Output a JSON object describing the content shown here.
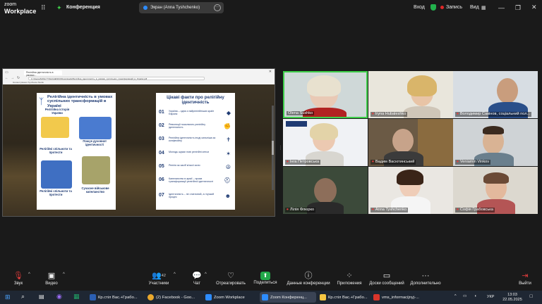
{
  "app": {
    "brand_line1": "zoom",
    "brand_line2": "Workplace",
    "meeting_title": "Конференция"
  },
  "screen_share": {
    "label": "Экран (Anna Tyshchenko)"
  },
  "top_right": {
    "login": "Вход",
    "record": "Запись",
    "view": "Вид"
  },
  "browser": {
    "tab_title": "Релігійна ідентичність в умовах...",
    "address": "C:/Users/ANNA TYSHCHENKO/Downloads/Релігійна_ідентичність_в_умовах_суспільних_трансформацій_в_Україні.pdf",
    "bookmarks": "Налаштування   Synthesia Studio"
  },
  "slide1": {
    "title": "Релігійна ідентичність в умовах суспільних трансформацій в Україні",
    "labels": [
      "Релігійна історія України",
      "Пошук духовної ідентичності",
      "Релігійні спільноти та протести",
      "Релігійні спільноти та протести",
      "Сучасне військове капеланство"
    ]
  },
  "slide2": {
    "title": "Цікаві факти про релігійну ідентичність",
    "facts": [
      {
        "n": "01",
        "t": "Україна – одна з найрелігійніших країн Європи"
      },
      {
        "n": "02",
        "t": "Революції посилюють релігійну ідентичність"
      },
      {
        "n": "03",
        "t": "Релігійна ідентичність іноді сильніша за конфесійну"
      },
      {
        "n": "04",
        "t": "Молодь шукає нові релігійні сенси"
      },
      {
        "n": "05",
        "t": "Релігія як засіб м'якої сили"
      },
      {
        "n": "06",
        "t": "Капеланство в армії – прояв трансформації релігійної ідентичності"
      },
      {
        "n": "07",
        "t": "Ідентичність – не статичний, а гнучкий процес"
      }
    ]
  },
  "participants": [
    {
      "name": "Olena Sushko",
      "muted": false,
      "active": true
    },
    {
      "name": "Iryna Hubaleshko",
      "muted": true,
      "active": false
    },
    {
      "name": "Володимир Савінов, соціальний пол...",
      "muted": true,
      "active": false
    },
    {
      "name": "Інга Петровська",
      "muted": true,
      "active": false
    },
    {
      "name": "Вадим Васютинський",
      "muted": true,
      "active": false
    },
    {
      "name": "Veniamin Vinkov",
      "muted": true,
      "active": false
    },
    {
      "name": "Лілія Флюрко",
      "muted": true,
      "active": false
    },
    {
      "name": "Anna Tyshchenko",
      "muted": true,
      "active": false
    },
    {
      "name": "Софія Грабовська",
      "muted": true,
      "active": false
    }
  ],
  "toolbar": {
    "audio": "Звук",
    "video": "Видео",
    "participants": "Участники",
    "participants_count": "42",
    "chat": "Чат",
    "react": "Отреагировать",
    "share": "Поделиться",
    "meeting_data": "Данные конференции",
    "apps": "Приложения",
    "whiteboards": "Доски сообщений",
    "more": "Дополнительно",
    "leave": "Выйти"
  },
  "taskbar": {
    "items": [
      "Кр.стіл Вас.+Грабо...",
      "(2) Facebook - Goo...",
      "Zoom Workplace",
      "Zoom Конференц...",
      "Кр.стіл Вас.+Грабо...",
      "vms_informacijnyj-..."
    ],
    "lang": "УКР",
    "time": "13:03",
    "date": "22.05.2025"
  },
  "colors": {
    "accent": "#2d8cff",
    "active_speaker": "#3fcf4a",
    "muted": "#e03c3c",
    "share_green": "#23a84a",
    "slide_blue": "#1f3b73"
  }
}
